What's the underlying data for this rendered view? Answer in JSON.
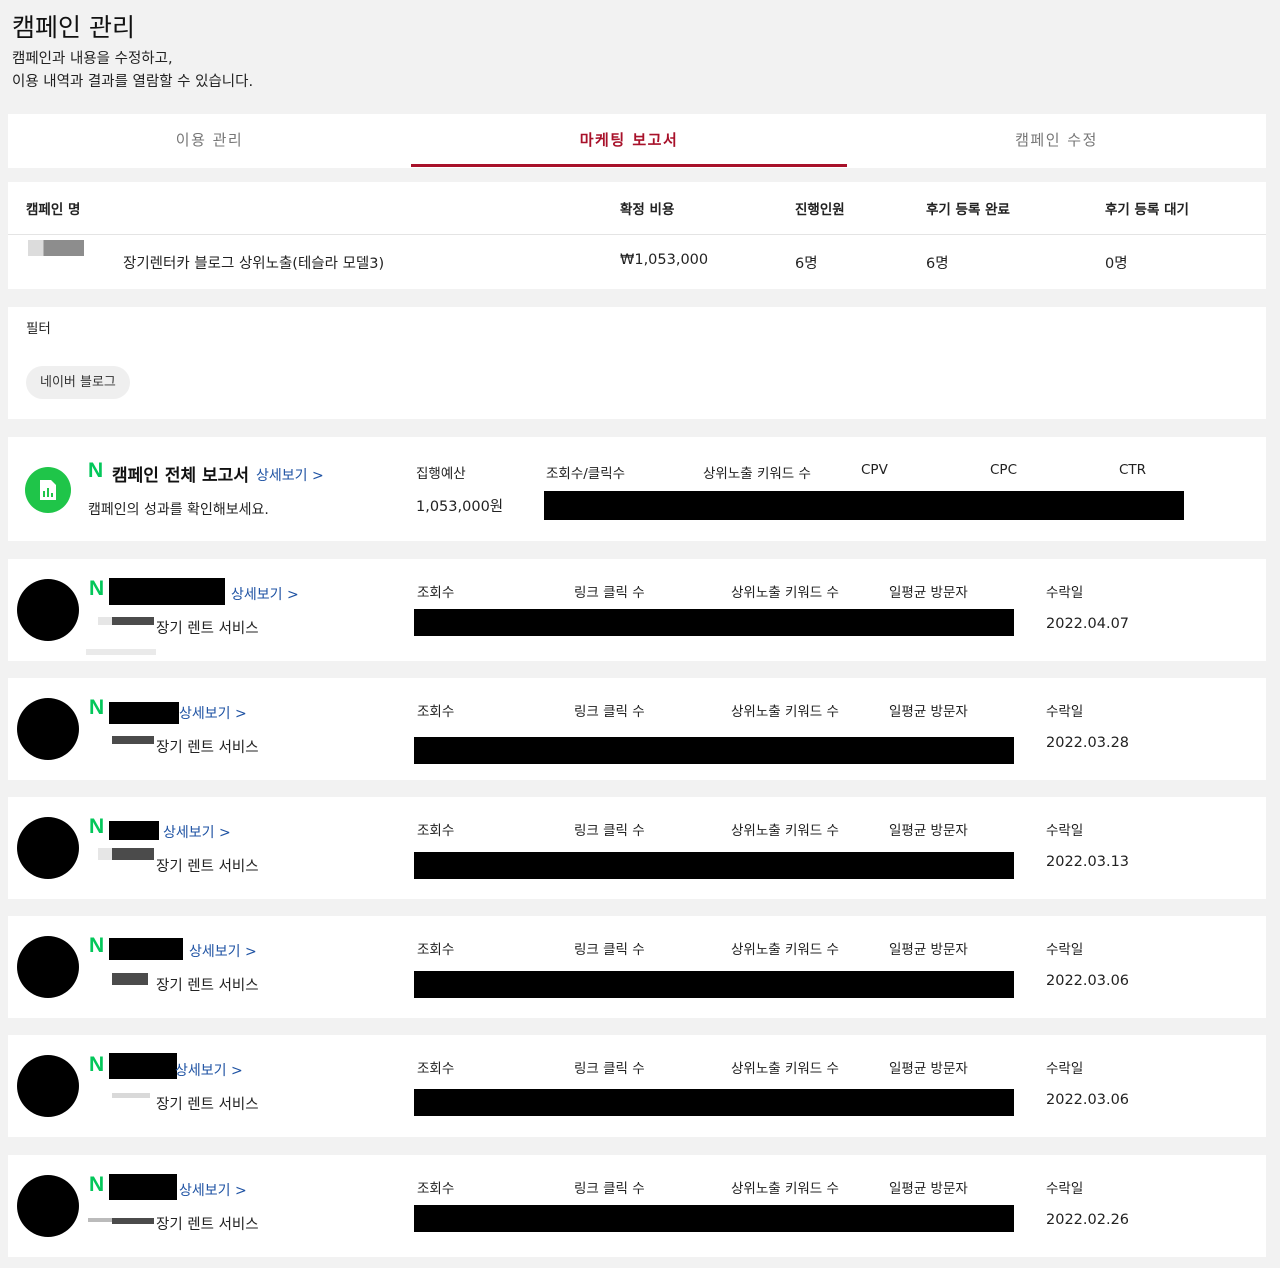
{
  "page": {
    "title": "캠페인 관리",
    "desc_line1": "캠페인과 내용을 수정하고,",
    "desc_line2": "이용 내역과 결과를 열람할 수 있습니다."
  },
  "tabs": [
    {
      "label": "이용 관리",
      "active": false
    },
    {
      "label": "마케팅 보고서",
      "active": true
    },
    {
      "label": "캠페인 수정",
      "active": false
    }
  ],
  "accent_color": "#a8112a",
  "naver_green": "#03c75a",
  "summary": {
    "headers": {
      "name": "캠페인 명",
      "cost": "확정 비용",
      "participants": "진행인원",
      "review_done": "후기 등록 완료",
      "review_wait": "후기 등록 대기"
    },
    "row": {
      "name": "장기렌터카 블로그 상위노출(테슬라 모델3)",
      "cost": "₩1,053,000",
      "participants": "6명",
      "review_done": "6명",
      "review_wait": "0명"
    }
  },
  "filter": {
    "title": "필터",
    "chip": "네이버 블로그"
  },
  "report": {
    "icon": "bar-chart-icon",
    "n_logo": "N",
    "title": "캠페인 전체 보고서",
    "more": "상세보기 >",
    "desc": "캠페인의 성과를 확인해보세요.",
    "metrics": {
      "budget": "집행예산",
      "views_clicks": "조회수/클릭수",
      "top_keywords": "상위노출 키워드 수",
      "cpv": "CPV",
      "cpc": "CPC",
      "ctr": "CTR"
    },
    "budget_value": "1,053,000원"
  },
  "post_columns": {
    "views": "조회수",
    "link_clicks": "링크 클릭 수",
    "top_keywords": "상위노출 키워드 수",
    "daily_visitors": "일평균 방문자",
    "accepted_date": "수락일"
  },
  "posts": [
    {
      "n_logo": "N",
      "more": "상세보기 >",
      "service": "장기 렌트 서비스",
      "date": "2022.04.07"
    },
    {
      "n_logo": "N",
      "more": "상세보기 >",
      "service": "장기 렌트 서비스",
      "date": "2022.03.28"
    },
    {
      "n_logo": "N",
      "more": "상세보기 >",
      "service": "장기 렌트 서비스",
      "date": "2022.03.13"
    },
    {
      "n_logo": "N",
      "more": "상세보기 >",
      "service": "장기 렌트 서비스",
      "date": "2022.03.06"
    },
    {
      "n_logo": "N",
      "more": "상세보기 >",
      "service": "장기 렌트 서비스",
      "date": "2022.03.06"
    },
    {
      "n_logo": "N",
      "more": "상세보기 >",
      "service": "장기 렌트 서비스",
      "date": "2022.02.26"
    }
  ]
}
